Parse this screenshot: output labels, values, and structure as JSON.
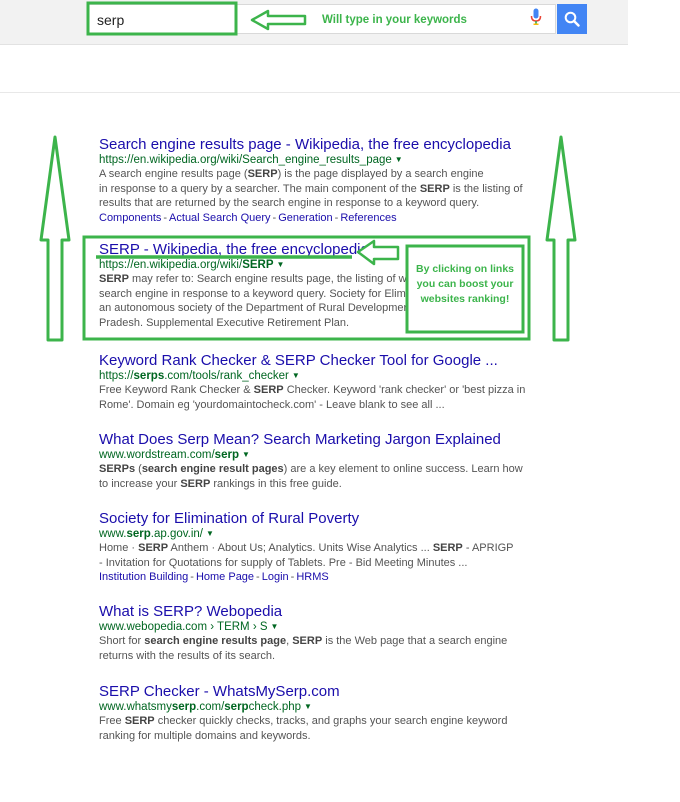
{
  "search": {
    "query": "serp",
    "mic_icon": "microphone-icon",
    "search_icon": "magnifier-icon"
  },
  "annotations": {
    "keywords_note": "Will type in your keywords",
    "click_note_lines": [
      "By clicking on links",
      "you can boost your",
      "websites ranking!"
    ],
    "color": "#3cb44b"
  },
  "results": [
    {
      "title": "Search engine results page - Wikipedia, the free encyclopedia",
      "url": "https://en.wikipedia.org/wiki/Search_engine_results_page",
      "snippet": [
        [
          {
            "t": "A search engine results page ("
          },
          {
            "t": "SERP",
            "b": true
          },
          {
            "t": ") is the page displayed by a search engine"
          }
        ],
        [
          {
            "t": "in response to a query by a searcher. The main component of the "
          },
          {
            "t": "SERP",
            "b": true
          },
          {
            "t": " is the listing of"
          }
        ],
        [
          {
            "t": "results that are returned by the search engine in response to a keyword query."
          }
        ]
      ],
      "links": [
        "Components",
        "Actual Search Query",
        "Generation",
        "References"
      ]
    },
    {
      "title": "SERP - Wikipedia, the free encyclopedia",
      "url_parts": [
        {
          "t": "https://en.wikipedia.org/wiki/"
        },
        {
          "t": "SERP",
          "b": true
        }
      ],
      "snippet": [
        [
          {
            "t": "SERP",
            "b": true
          },
          {
            "t": " may refer to: Search engine results page, the listing of web p"
          }
        ],
        [
          {
            "t": "search engine in response to a keyword query. Society for Eliminat"
          }
        ],
        [
          {
            "t": "an autonomous society of the Department of Rural Development, G"
          }
        ],
        [
          {
            "t": "Pradesh. Supplemental Executive Retirement Plan."
          }
        ]
      ]
    },
    {
      "title": "Keyword Rank Checker & SERP Checker Tool for Google ...",
      "url_parts": [
        {
          "t": "https://"
        },
        {
          "t": "serps",
          "b": true
        },
        {
          "t": ".com/tools/rank_checker"
        }
      ],
      "snippet": [
        [
          {
            "t": "Free Keyword Rank Checker & "
          },
          {
            "t": "SERP",
            "b": true
          },
          {
            "t": " Checker. Keyword 'rank checker' or 'best pizza in"
          }
        ],
        [
          {
            "t": "Rome'. Domain eg 'yourdomaintocheck.com' - Leave blank to see all ..."
          }
        ]
      ]
    },
    {
      "title": "What Does Serp Mean? Search Marketing Jargon Explained",
      "url_parts": [
        {
          "t": "www.wordstream.com/"
        },
        {
          "t": "serp",
          "b": true
        }
      ],
      "snippet": [
        [
          {
            "t": "SERPs",
            "b": true
          },
          {
            "t": " ("
          },
          {
            "t": "search engine result pages",
            "b": true
          },
          {
            "t": ") are a key element to online success. Learn how"
          }
        ],
        [
          {
            "t": "to increase your "
          },
          {
            "t": "SERP",
            "b": true
          },
          {
            "t": " rankings in this free guide."
          }
        ]
      ]
    },
    {
      "title": "Society for Elimination of Rural Poverty",
      "url_parts": [
        {
          "t": "www."
        },
        {
          "t": "serp",
          "b": true
        },
        {
          "t": ".ap.gov.in/"
        }
      ],
      "snippet": [
        [
          {
            "t": "Home · "
          },
          {
            "t": "SERP",
            "b": true
          },
          {
            "t": " Anthem · About Us; Analytics. Units Wise Analytics ... "
          },
          {
            "t": "SERP",
            "b": true
          },
          {
            "t": " - APRIGP"
          }
        ],
        [
          {
            "t": "- Invitation for Quotations for supply of Tablets. Pre - Bid Meeting Minutes ..."
          }
        ]
      ],
      "links": [
        "Institution Building",
        "Home Page",
        "Login",
        "HRMS"
      ]
    },
    {
      "title": "What is SERP? Webopedia",
      "url": "www.webopedia.com › TERM › S",
      "snippet": [
        [
          {
            "t": "Short for "
          },
          {
            "t": "search engine results page",
            "b": true
          },
          {
            "t": ", "
          },
          {
            "t": "SERP",
            "b": true
          },
          {
            "t": " is the Web page that a search engine"
          }
        ],
        [
          {
            "t": "returns with the results of its search."
          }
        ]
      ]
    },
    {
      "title": "SERP Checker - WhatsMySerp.com",
      "url_parts": [
        {
          "t": "www.whatsmy"
        },
        {
          "t": "serp",
          "b": true
        },
        {
          "t": ".com/"
        },
        {
          "t": "serp",
          "b": true
        },
        {
          "t": "check.php"
        }
      ],
      "snippet": [
        [
          {
            "t": "Free "
          },
          {
            "t": "SERP",
            "b": true
          },
          {
            "t": " checker quickly checks, tracks, and graphs your search engine keyword"
          }
        ],
        [
          {
            "t": "ranking for multiple domains and keywords."
          }
        ]
      ]
    }
  ]
}
